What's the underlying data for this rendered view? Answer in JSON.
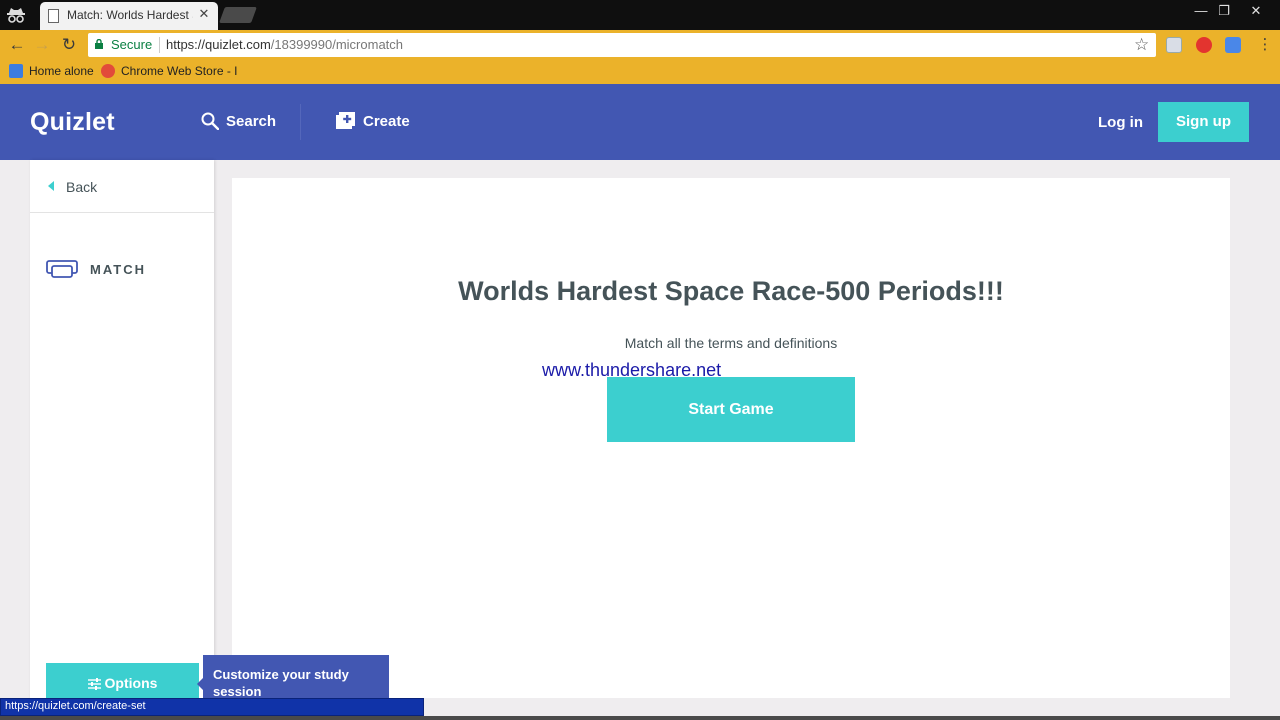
{
  "browser": {
    "tab_title": "Match: Worlds Hardest Sp",
    "tab_close": "✕",
    "window_controls": {
      "minimize": "—",
      "restore": "❐",
      "close": "✕"
    },
    "nav": {
      "back": "←",
      "forward": "→",
      "reload": "↻"
    },
    "secure_label": "Secure",
    "url_host": "https://quizlet.com",
    "url_path": "/18399990/micromatch",
    "star": "☆",
    "bookmarks": [
      {
        "label": "Home alone",
        "icon": "pinned-bookmark-icon",
        "color": "#3c7de0"
      },
      {
        "label": "Chrome Web Store - I",
        "icon": "chrome-store-icon",
        "color": "#e24b3a"
      }
    ],
    "status_url": "https://quizlet.com/create-set"
  },
  "header": {
    "logo": "Quizlet",
    "search_label": "Search",
    "create_label": "Create",
    "login_label": "Log in",
    "signup_label": "Sign up"
  },
  "sidebar": {
    "back_label": "Back",
    "mode_label": "MATCH"
  },
  "main": {
    "set_title": "Worlds Hardest Space Race-500 Periods!!!",
    "subtitle": "Match all the terms and definitions",
    "start_label": "Start Game",
    "watermark": "www.thundershare.net"
  },
  "options": {
    "label": "Options",
    "tooltip": "Customize your study session"
  },
  "colors": {
    "brand_blue": "#4257b2",
    "teal": "#3ccfcf",
    "chrome_toolbar": "#ebb22a",
    "text_dark": "#455358"
  }
}
